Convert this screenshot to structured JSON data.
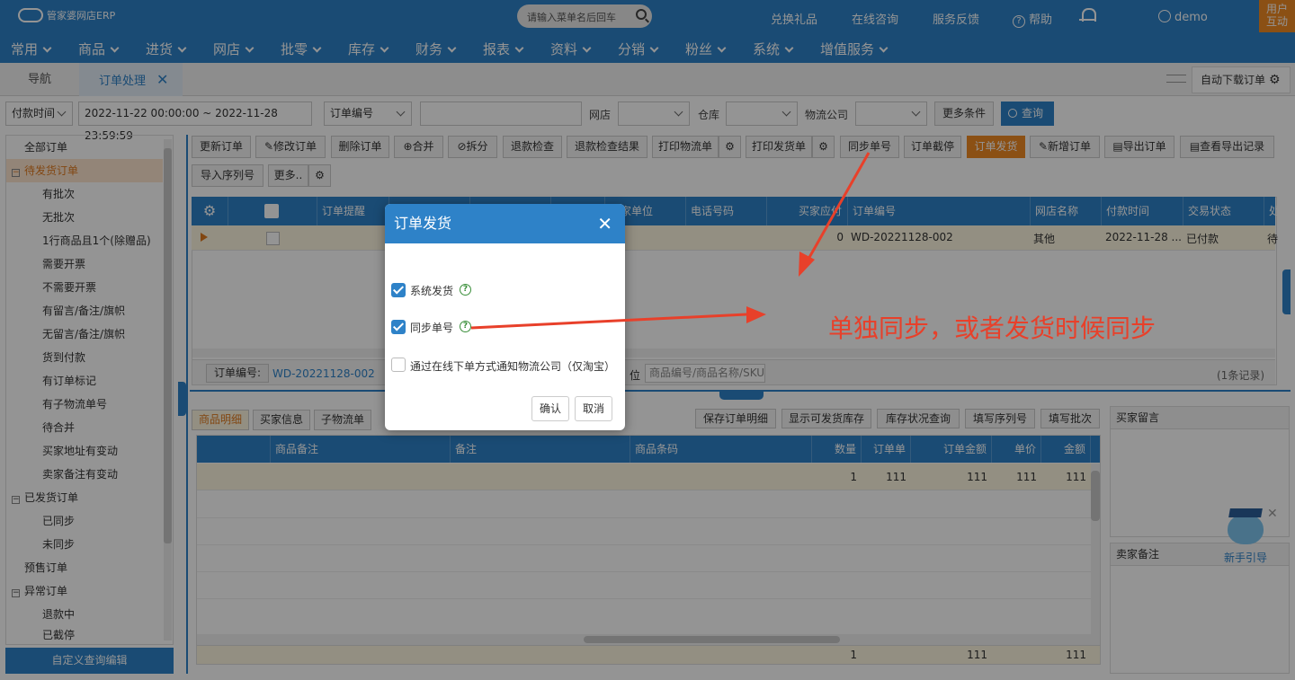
{
  "app": {
    "logo_text": "管家婆网店ERP",
    "search_placeholder": "请输入菜单名后回车"
  },
  "top_links": {
    "gift": "兑换礼品",
    "consult": "在线咨询",
    "feedback": "服务反馈",
    "help": "帮助",
    "user": "demo",
    "user_box_line1": "用户",
    "user_box_line2": "互动"
  },
  "nav": [
    "常用",
    "商品",
    "进货",
    "网店",
    "批零",
    "库存",
    "财务",
    "报表",
    "资料",
    "分销",
    "粉丝",
    "系统",
    "增值服务"
  ],
  "tabs": {
    "nav": "导航",
    "order": "订单处理",
    "auto_download": "自动下载订单"
  },
  "filters": {
    "time_type": "付款时间",
    "date_range": "2022-11-22 00:00:00 ~ 2022-11-28 23:59:59",
    "field": "订单编号",
    "shop_label": "网店",
    "warehouse_label": "仓库",
    "logistics_label": "物流公司",
    "more": "更多条件",
    "query": "查询"
  },
  "sidebar": {
    "items": [
      "全部订单",
      "待发货订单",
      "有批次",
      "无批次",
      "1行商品且1个(除赠品)",
      "需要开票",
      "不需要开票",
      "有留言/备注/旗帜",
      "无留言/备注/旗帜",
      "货到付款",
      "有订单标记",
      "有子物流单号",
      "待合并",
      "买家地址有变动",
      "卖家备注有变动",
      "已发货订单",
      "已同步",
      "未同步",
      "预售订单",
      "异常订单",
      "退款中",
      "已截停"
    ],
    "custom_btn": "自定义查询编辑"
  },
  "toolbar": [
    "更新订单",
    "修改订单",
    "删除订单",
    "合并",
    "拆分",
    "退款检查",
    "退款检查结果",
    "打印物流单",
    "打印发货单",
    "同步单号",
    "订单截停",
    "订单发货",
    "新增订单",
    "导出订单",
    "查看导出记录"
  ],
  "toolbar2": [
    "导入序列号",
    "更多.."
  ],
  "grid": {
    "headers": [
      "订单提醒",
      "",
      "",
      "",
      "买家单位",
      "电话号码",
      "买家应付",
      "订单编号",
      "网店名称",
      "付款时间",
      "交易状态",
      "处"
    ],
    "row": {
      "tel": "",
      "pay": "0",
      "order_no": "WD-20221128-002",
      "shop": "其他",
      "time": "2022-11-28 ...",
      "status": "已付款",
      "other": "待",
      "unit": "他"
    },
    "footer": {
      "order_label": "订单编号:",
      "order_no": "WD-20221128-002",
      "search_placeholder": "商品编号/商品名称/SKU",
      "count": "(1条记录)",
      "left_frag": "位"
    }
  },
  "bottom": {
    "tabs": [
      "商品明细",
      "买家信息",
      "子物流单"
    ],
    "actions": [
      "保存订单明细",
      "显示可发货库存",
      "库存状况查询",
      "填写序列号",
      "填写批次"
    ],
    "headers": [
      "商品备注",
      "备注",
      "商品条码",
      "数量",
      "订单单价",
      "订单金额",
      "单价",
      "金额"
    ],
    "row": {
      "qty": "1",
      "oprice": "111",
      "oamt": "111",
      "price": "111",
      "amt": "111"
    },
    "total": {
      "qty": "1",
      "oamt": "111",
      "amt": "111"
    },
    "buyer_msg": "买家留言",
    "seller_note": "卖家备注",
    "guide": "新手引导"
  },
  "dialog": {
    "title": "订单发货",
    "opt1": "系统发货",
    "opt2": "同步单号",
    "opt3": "通过在线下单方式通知物流公司（仅淘宝）",
    "ok": "确认",
    "cancel": "取消",
    "opt1_checked": true,
    "opt2_checked": true,
    "opt3_checked": false
  },
  "annotation": "单独同步，或者发货时候同步",
  "colors": {
    "primary": "#2e82c8",
    "orange": "#f08a24",
    "annotation": "#e8402a",
    "selected_row": "#fdf7e0"
  }
}
